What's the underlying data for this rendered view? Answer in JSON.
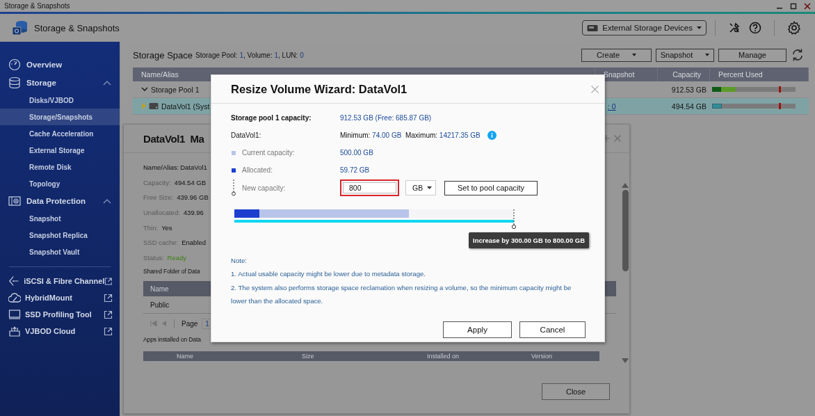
{
  "window": {
    "title": "Storage & Snapshots"
  },
  "app": {
    "title": "Storage & Snapshots",
    "device_menu": "External Storage Devices"
  },
  "sidebar": {
    "items": [
      {
        "kind": "item",
        "label": "Overview",
        "selected": false
      },
      {
        "kind": "group",
        "label": "Storage",
        "expanded": true,
        "selected": false,
        "children": [
          {
            "label": "Disks/VJBOD",
            "selected": false
          },
          {
            "label": "Storage/Snapshots",
            "selected": true
          },
          {
            "label": "Cache Acceleration",
            "selected": false
          },
          {
            "label": "External Storage",
            "selected": false
          },
          {
            "label": "Remote Disk",
            "selected": false
          },
          {
            "label": "Topology",
            "selected": false
          }
        ]
      },
      {
        "kind": "group",
        "label": "Data Protection",
        "expanded": true,
        "selected": false,
        "children": [
          {
            "label": "Snapshot",
            "selected": false
          },
          {
            "label": "Snapshot Replica",
            "selected": false
          },
          {
            "label": "Snapshot Vault",
            "selected": false
          }
        ]
      }
    ],
    "links": [
      {
        "label": "iSCSI & Fibre Channel"
      },
      {
        "label": "HybridMount"
      },
      {
        "label": "SSD Profiling Tool"
      },
      {
        "label": "VJBOD Cloud"
      }
    ]
  },
  "storage_space": {
    "title": "Storage Space",
    "summary": [
      {
        "label": "Storage Pool:",
        "value": "1"
      },
      {
        "label": ", Volume:",
        "value": "1"
      },
      {
        "label": ", LUN:",
        "value": "0"
      }
    ],
    "buttons": [
      {
        "label": "Create",
        "dropdown": true
      },
      {
        "label": "Snapshot",
        "dropdown": true
      },
      {
        "label": "Manage",
        "dropdown": false
      }
    ]
  },
  "table": {
    "columns": [
      "Name/Alias",
      "Snapshot",
      "Capacity",
      "Percent Used"
    ],
    "rows": [
      {
        "kind": "pool",
        "name": "Storage Pool 1",
        "expanded": true,
        "selected": false,
        "capacity": "912.53 GB",
        "usage": [
          {
            "kind": "used",
            "level": 0.11
          },
          {
            "kind": "allocated",
            "level": 0.17
          }
        ],
        "threshold": {
          "level": 0.8
        }
      },
      {
        "kind": "volume",
        "name": "DataVol1 (Syst",
        "selected": true,
        "snapshot": ": 0",
        "capacity": "494.54 GB",
        "usage": [
          {
            "kind": "volume",
            "level": 0.12
          }
        ],
        "threshold": {
          "level": 0.8
        }
      }
    ]
  },
  "detail_panel": {
    "title": "DataVol1  Ma",
    "fields": [
      {
        "label": "Name/Alias:",
        "value": "DataVol1",
        "emphasis": true
      },
      {
        "label": "Capacity:",
        "value": "494.54 GB",
        "emphasis": false
      },
      {
        "label": "Free Size:",
        "value": "439.96 GB",
        "emphasis": false
      },
      {
        "label": "Unallocated:",
        "value": "439.96",
        "emphasis": false
      },
      {
        "label": "Thin:",
        "value": "Yes",
        "emphasis": false
      },
      {
        "label": "SSD cache:",
        "value": "Enabled",
        "emphasis": false
      },
      {
        "label": "Status:",
        "value": "Ready",
        "emphasis": false,
        "success": true
      }
    ],
    "shared_folders": {
      "heading": "Shared Folder of Data",
      "columns": [
        "Name"
      ],
      "rows": [
        "Public"
      ],
      "pager": {
        "label": "Page",
        "page": "1"
      }
    },
    "apps": {
      "heading": "Apps installed on Data",
      "columns": [
        "Name",
        "Size",
        "Installed on",
        "Version"
      ]
    },
    "close_button": "Close"
  },
  "dialog": {
    "title": "Resize Volume Wizard: DataVol1",
    "pool_capacity": {
      "label": "Storage pool 1 capacity:",
      "value": "912.53 GB (Free: 685.87 GB)"
    },
    "volume_limits": {
      "label": "DataVol1:",
      "min_label": "Minimum:",
      "min": "74.00 GB",
      "max_label": "Maximum:",
      "max": "14217.35 GB"
    },
    "current": {
      "label": "Current capacity:",
      "value": "500.00 GB"
    },
    "allocated": {
      "label": "Allocated:",
      "value": "59.72 GB"
    },
    "new_capacity": {
      "label": "New capacity:",
      "value": "800",
      "highlighted": true,
      "unit": "GB",
      "button": "Set to pool capacity"
    },
    "capacity_bar": {
      "segments": [
        {
          "kind": "allocated",
          "level": 0.09
        },
        {
          "kind": "current",
          "level": 0.625
        },
        {
          "kind": "new",
          "level": 1
        }
      ],
      "tooltip": "Increase by 300.00 GB to 800.00 GB"
    },
    "notes": {
      "heading": "Note:",
      "items": [
        "1. Actual usable capacity might be lower due to metadata storage.",
        "2. The system also performs storage space reclamation when resizing a volume, so the minimum capacity might be lower than the allocated space."
      ]
    },
    "buttons": [
      "Apply",
      "Cancel"
    ]
  }
}
